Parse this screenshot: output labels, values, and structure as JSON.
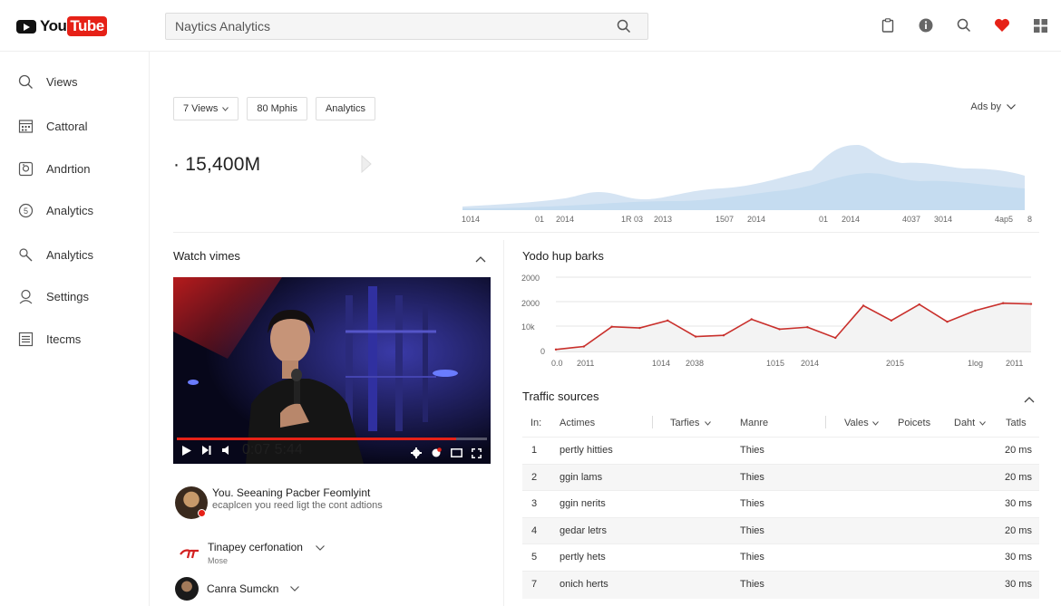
{
  "header": {
    "logo_you": "You",
    "logo_tube": "Tube",
    "search_value": "Naytics Analytics",
    "icons": [
      "clipboard-icon",
      "info-icon",
      "search-icon",
      "heart-icon",
      "grid-icon"
    ],
    "accent": "#e62117"
  },
  "sidebar": {
    "items": [
      {
        "label": "Views",
        "icon": "search-icon"
      },
      {
        "label": "Cattoral",
        "icon": "calendar-icon"
      },
      {
        "label": "Andrtion",
        "icon": "image-icon"
      },
      {
        "label": "Analytics",
        "icon": "clock-icon"
      },
      {
        "label": "Analytics",
        "icon": "pen-icon"
      },
      {
        "label": "Settings",
        "icon": "person-icon"
      },
      {
        "label": "Itecms",
        "icon": "list-icon"
      }
    ]
  },
  "filters": {
    "chip1": "7 Views",
    "chip2": "80 Mphis",
    "chip3": "Analytics",
    "add_by": "Ads by"
  },
  "overview": {
    "metric_prefix": "·",
    "metric_value": "15,400M"
  },
  "area_chart": {
    "x_labels": [
      "1014",
      "01",
      "2014",
      "1R 03",
      "2013",
      "1507",
      "2014",
      "01",
      "2014",
      "4037",
      "3014",
      "4ap5",
      "8"
    ],
    "fill_color": "#c5dcf0"
  },
  "watch": {
    "title": "Watch vimes",
    "video_time": "0:07 5:44",
    "progress_value": 0.9,
    "channel_name": "You. Seeaning Pacber Feomlyint",
    "channel_desc": "ecaplcen you reed ligt the cont adtions",
    "row1_label": "Tinapey cerfonation",
    "row1_sub": "Mose",
    "row2_label": "Canra Sumckn"
  },
  "line_section": {
    "title": "Yodo hup barks",
    "y_labels": [
      "2000",
      "2000",
      "10k",
      "0"
    ],
    "x_labels": [
      "0.0",
      "2011",
      "1014",
      "2038",
      "1015",
      "2014",
      "2015",
      "1log",
      "2011"
    ],
    "line_color": "#c9302c"
  },
  "chart_data": {
    "type": "line",
    "title": "Yodo hup barks",
    "y_ticks": [
      "2000",
      "2000",
      "10k",
      "0"
    ],
    "x_ticks": [
      "0.0",
      "2011",
      "1014",
      "2038",
      "1015",
      "2014",
      "2015",
      "1log",
      "2011"
    ],
    "series": [
      {
        "values": [
          0.08,
          0.2,
          1.0,
          0.95,
          1.25,
          0.6,
          0.65,
          1.3,
          0.9,
          0.98,
          0.55,
          1.85,
          1.25,
          1.9,
          1.2,
          1.65,
          1.95,
          1.92
        ]
      }
    ],
    "ylim": [
      0,
      3
    ],
    "grid": true
  },
  "traffic": {
    "title": "Traffic sources",
    "headers": {
      "c1": "In:",
      "c2": "Actimes",
      "c3": "Tarfies",
      "c4": "Manre",
      "c5": "Vales",
      "c6": "Poicets",
      "c7": "Daht",
      "c8": "Tatls"
    },
    "rows": [
      {
        "n": "1",
        "name": "pertly hitties",
        "manre": "Thies",
        "total": "20 ms"
      },
      {
        "n": "2",
        "name": "ggin lams",
        "manre": "Thies",
        "total": "20 ms"
      },
      {
        "n": "3",
        "name": "ggin nerits",
        "manre": "Thies",
        "total": "30 ms"
      },
      {
        "n": "4",
        "name": "gedar letrs",
        "manre": "Thies",
        "total": "20 ms"
      },
      {
        "n": "5",
        "name": "pertly hets",
        "manre": "Thies",
        "total": "30 ms"
      },
      {
        "n": "7",
        "name": "onich herts",
        "manre": "Thies",
        "total": "30 ms"
      }
    ]
  }
}
